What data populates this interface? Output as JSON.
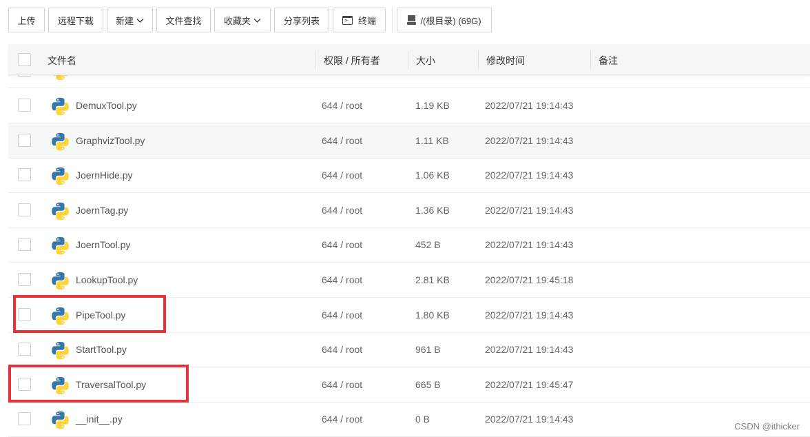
{
  "toolbar": {
    "upload": "上传",
    "remote_download": "远程下载",
    "new": "新建",
    "file_search": "文件查找",
    "favorites": "收藏夹",
    "share_list": "分享列表",
    "terminal": "终端",
    "disk": "/(根目录) (69G)"
  },
  "table": {
    "columns": {
      "name": "文件名",
      "permission_owner": "权限 / 所有者",
      "size": "大小",
      "modified": "修改时间",
      "note": "备注"
    },
    "rows": [
      {
        "name": "DemuxTool.py",
        "perm": "644 / root",
        "size": "1.19 KB",
        "mtime": "2022/07/21 19:14:43",
        "highlighted": false,
        "red_boxed": false
      },
      {
        "name": "GraphvizTool.py",
        "perm": "644 / root",
        "size": "1.11 KB",
        "mtime": "2022/07/21 19:14:43",
        "highlighted": true,
        "red_boxed": false
      },
      {
        "name": "JoernHide.py",
        "perm": "644 / root",
        "size": "1.06 KB",
        "mtime": "2022/07/21 19:14:43",
        "highlighted": false,
        "red_boxed": false
      },
      {
        "name": "JoernTag.py",
        "perm": "644 / root",
        "size": "1.36 KB",
        "mtime": "2022/07/21 19:14:43",
        "highlighted": false,
        "red_boxed": false
      },
      {
        "name": "JoernTool.py",
        "perm": "644 / root",
        "size": "452 B",
        "mtime": "2022/07/21 19:14:43",
        "highlighted": false,
        "red_boxed": false
      },
      {
        "name": "LookupTool.py",
        "perm": "644 / root",
        "size": "2.81 KB",
        "mtime": "2022/07/21 19:45:18",
        "highlighted": false,
        "red_boxed": false
      },
      {
        "name": "PipeTool.py",
        "perm": "644 / root",
        "size": "1.80 KB",
        "mtime": "2022/07/21 19:14:43",
        "highlighted": false,
        "red_boxed": true
      },
      {
        "name": "StartTool.py",
        "perm": "644 / root",
        "size": "961 B",
        "mtime": "2022/07/21 19:14:43",
        "highlighted": false,
        "red_boxed": false
      },
      {
        "name": "TraversalTool.py",
        "perm": "644 / root",
        "size": "665 B",
        "mtime": "2022/07/21 19:45:47",
        "highlighted": false,
        "red_boxed": true
      },
      {
        "name": "__init__.py",
        "perm": "644 / root",
        "size": "0 B",
        "mtime": "2022/07/21 19:14:43",
        "highlighted": false,
        "red_boxed": false
      }
    ]
  },
  "colors": {
    "annotation_red": "#e8313a",
    "row_highlight": "#f4f9f7",
    "header_bg": "#f6f6f6",
    "python_blue": "#3776ab",
    "python_yellow": "#ffd43b"
  },
  "icons": {
    "file_type": "python-file-icon",
    "terminal": "terminal-icon",
    "disk": "disk-icon",
    "dropdown": "chevron-down-icon"
  },
  "watermark": "CSDN @ithicker"
}
